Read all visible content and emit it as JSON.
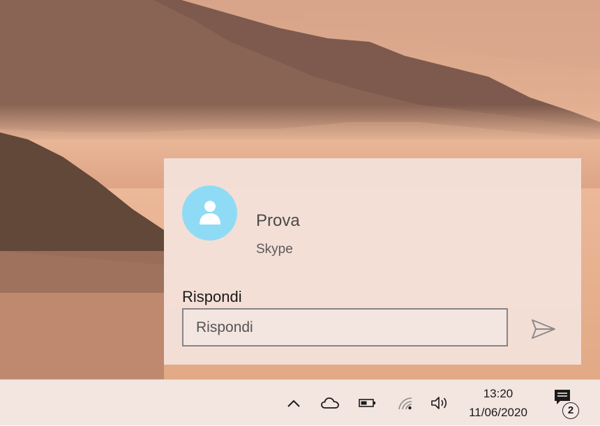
{
  "notification": {
    "sender": "Prova",
    "app": "Skype",
    "reply_label": "Rispondi",
    "reply_placeholder": "Rispondi"
  },
  "taskbar": {
    "time": "13:20",
    "date": "11/06/2020",
    "notification_count": "2",
    "tray_icons": [
      "chevron-up-icon",
      "cloud-icon",
      "battery-icon",
      "wifi-icon",
      "volume-icon",
      "action-center-icon"
    ]
  },
  "colors": {
    "avatar": "#8fdbf6",
    "toast_bg": "#f4e2db",
    "taskbar_bg": "#f3e5e0"
  }
}
